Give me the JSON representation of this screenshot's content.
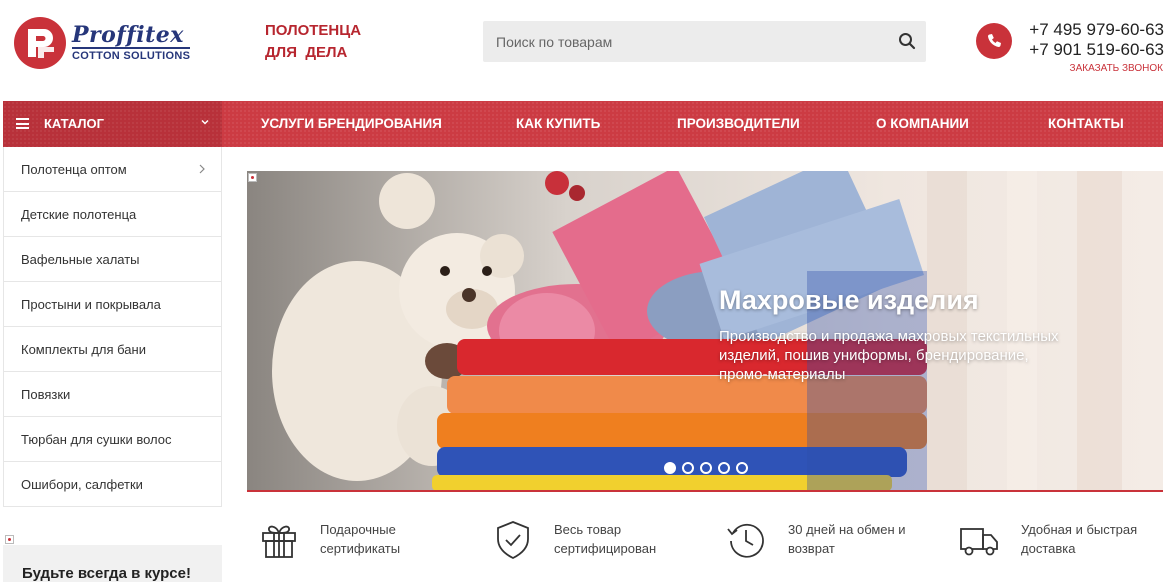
{
  "logo": {
    "main": "Proffitex",
    "sub": "COTTON SOLUTIONS"
  },
  "tagline": {
    "line1": "ПОЛОТЕНЦА",
    "line2": "ДЛЯ  ДЕЛА"
  },
  "search": {
    "placeholder": "Поиск по товарам"
  },
  "contacts": {
    "phone1": "+7 495 979-60-63",
    "phone2": "+7 901 519-60-63",
    "callback": "ЗАКАЗАТЬ ЗВОНОК"
  },
  "nav": {
    "catalog": "КАТАЛОГ",
    "items": [
      "УСЛУГИ БРЕНДИРОВАНИЯ",
      "КАК КУПИТЬ",
      "ПРОИЗВОДИТЕЛИ",
      "О КОМПАНИИ",
      "КОНТАКТЫ"
    ]
  },
  "sidebar": {
    "items": [
      {
        "label": "Полотенца оптом"
      },
      {
        "label": "Детские полотенца"
      },
      {
        "label": "Вафельные халаты"
      },
      {
        "label": "Простыни и покрывала"
      },
      {
        "label": "Комплекты для бани"
      },
      {
        "label": "Повязки"
      },
      {
        "label": "Тюрбан для сушки волос"
      },
      {
        "label": "Ошибори, салфетки"
      }
    ],
    "subscribe": "Будьте всегда в курсе!"
  },
  "banner": {
    "title": "Махровые изделия",
    "text": "Производство и продажа махровых текстильных изделий, пошив униформы, брендирование, промо-материалы",
    "slides": 5,
    "active_slide": 1
  },
  "features": [
    {
      "line1": "Подарочные",
      "line2": "сертификаты",
      "icon": "gift-icon"
    },
    {
      "line1": "Весь товар",
      "line2": "сертифицирован",
      "icon": "shield-check-icon"
    },
    {
      "line1": "30 дней на обмен и",
      "line2": "возврат",
      "icon": "clock-icon"
    },
    {
      "line1": "Удобная и быстрая",
      "line2": "доставка",
      "icon": "truck-icon"
    }
  ],
  "colors": {
    "accent": "#c9323a",
    "nav": "#cc3b43",
    "brand_blue": "#26367a"
  }
}
